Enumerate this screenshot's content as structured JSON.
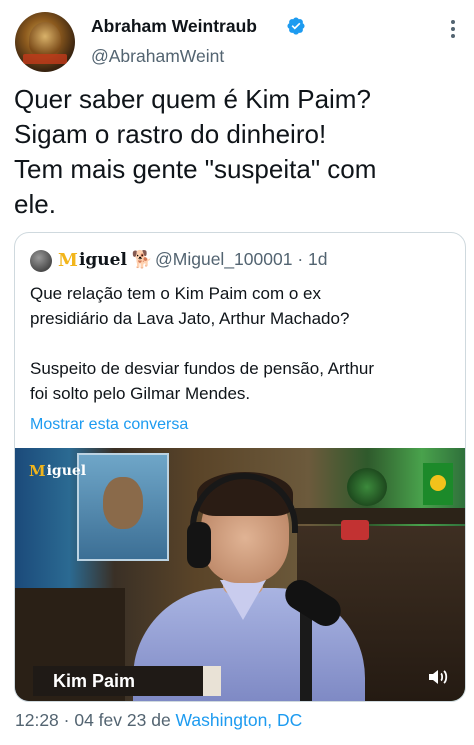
{
  "author": {
    "display_name": "Abraham Weintraub",
    "handle": "@AbrahamWeint",
    "verified": true,
    "avatar_icon": "profile-avatar"
  },
  "tweet": {
    "lines": [
      "Quer saber quem é Kim Paim?",
      "Sigam o rastro do dinheiro!",
      "Tem mais gente \"suspeita\" com",
      "ele."
    ]
  },
  "quoted": {
    "name_prefix": "M",
    "name": "iguel",
    "handle": "@Miguel_100001",
    "time": "· 1d",
    "lines_p1": [
      "Que relação tem o Kim Paim com o ex",
      "presidiário da Lava Jato, Arthur Machado?"
    ],
    "lines_p2": [
      "Suspeito de desviar fundos de pensão, Arthur",
      "foi solto pelo Gilmar Mendes."
    ],
    "show_thread": "Mostrar esta conversa",
    "video": {
      "logo_prefix": "M",
      "logo_name": "iguel",
      "caption": "Kim Paim"
    }
  },
  "footer": {
    "time_date": "12:28 · 04 fev 23 de ",
    "location": "Washington, DC"
  },
  "colors": {
    "link": "#1d9bf0",
    "secondary_text": "#536471",
    "primary_text": "#0f1419",
    "verified": "#1d9bf0",
    "border": "#cfd9de"
  }
}
